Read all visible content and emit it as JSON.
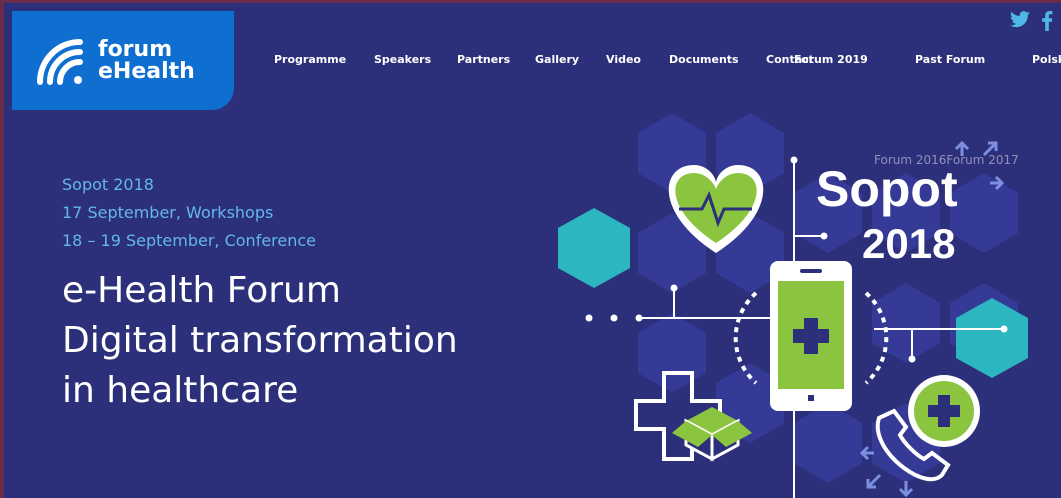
{
  "logo": {
    "line1": "forum",
    "line2": "eHealth"
  },
  "nav": {
    "items": [
      {
        "label": "Programme",
        "name": "nav-programme"
      },
      {
        "label": "Speakers",
        "name": "nav-speakers"
      },
      {
        "label": "Partners",
        "name": "nav-partners"
      },
      {
        "label": "Gallery",
        "name": "nav-gallery"
      },
      {
        "label": "Video",
        "name": "nav-video"
      },
      {
        "label": "Documents",
        "name": "nav-documents"
      },
      {
        "label": "Contact",
        "name": "nav-contact"
      },
      {
        "label": "Forum 2019",
        "name": "nav-forum-2019"
      },
      {
        "label": "Past Forum",
        "name": "nav-past-forum"
      },
      {
        "label": "Polski",
        "name": "nav-polski"
      }
    ]
  },
  "social": {
    "twitter_icon": "twitter-icon",
    "facebook_icon": "facebook-icon"
  },
  "past_links": {
    "forum_2016": "Forum 2016",
    "forum_2017": "Forum 2017"
  },
  "event": {
    "location": "Sopot 2018",
    "workshops": "17 September, Workshops",
    "conference": "18 – 19 September, Conference"
  },
  "headline": {
    "line1": "e-Health Forum",
    "line2": "Digital transformation",
    "line3": "in healthcare"
  },
  "hero": {
    "word": "Sopot",
    "year": "2018"
  },
  "colors": {
    "background": "#2c2f7a",
    "logo_bg": "#0e6fd1",
    "accent_blue": "#64b7ee",
    "accent_green": "#8bc53f",
    "teal": "#2cb6bf",
    "hex_dark": "#3a3f9a"
  }
}
